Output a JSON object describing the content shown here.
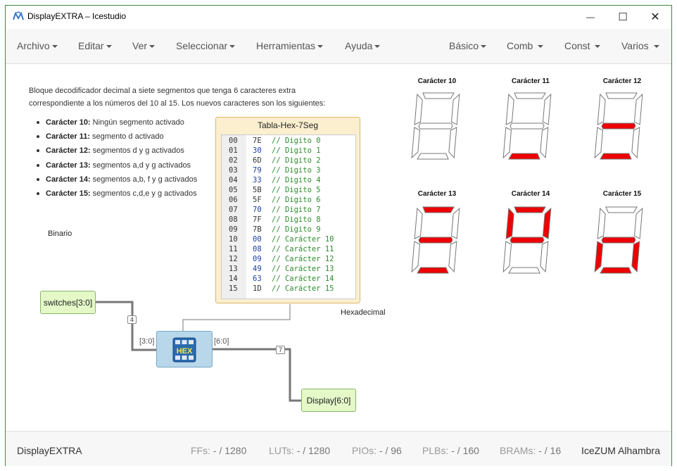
{
  "window": {
    "title": "DisplayEXTRA – Icestudio",
    "controls": {
      "minimize": "—",
      "maximize": "☐",
      "close": "✕"
    }
  },
  "menubar": {
    "left": [
      "Archivo",
      "Editar",
      "Ver",
      "Seleccionar",
      "Herramientas",
      "Ayuda"
    ],
    "right": [
      "Básico",
      "Comb",
      "Const",
      "Varios"
    ]
  },
  "canvas": {
    "description_line1": "Bloque decodificador decimal a siete segmentos que tenga 6 caracteres extra",
    "description_line2": "correspondiente a los números del 10 al 15. Los nuevos caracteres son los siguientes:",
    "bullets": [
      {
        "bold": "Carácter 10:",
        "text": " Ningún segmento activado"
      },
      {
        "bold": "Carácter 11:",
        "text": " segmento d activado"
      },
      {
        "bold": "Carácter 12:",
        "text": " segmentos d y g activados"
      },
      {
        "bold": "Carácter 13:",
        "text": " segmentos a,d y g activados"
      },
      {
        "bold": "Carácter 14:",
        "text": " segmentos a,b, f y g activados"
      },
      {
        "bold": "Carácter 15:",
        "text": " segmentos c,d,e y g activados"
      }
    ],
    "label_binario": "Binario",
    "label_hexadecimal": "Hexadecimal",
    "memory": {
      "title": "Tabla-Hex-7Seg",
      "rows": [
        {
          "addr": "00",
          "val": "7E",
          "comment": "// Digito 0",
          "blue": false
        },
        {
          "addr": "01",
          "val": "30",
          "comment": "// Digito 1",
          "blue": true
        },
        {
          "addr": "02",
          "val": "6D",
          "comment": "// Digito 2",
          "blue": false
        },
        {
          "addr": "03",
          "val": "79",
          "comment": "// Digito 3",
          "blue": true
        },
        {
          "addr": "04",
          "val": "33",
          "comment": "// Digito 4",
          "blue": true
        },
        {
          "addr": "05",
          "val": "5B",
          "comment": "// Digito 5",
          "blue": false
        },
        {
          "addr": "06",
          "val": "5F",
          "comment": "// Digito 6",
          "blue": false
        },
        {
          "addr": "07",
          "val": "70",
          "comment": "// Digito 7",
          "blue": true
        },
        {
          "addr": "08",
          "val": "7F",
          "comment": "// Digito 8",
          "blue": false
        },
        {
          "addr": "09",
          "val": "7B",
          "comment": "// Digito 9",
          "blue": false
        },
        {
          "addr": "10",
          "val": "00",
          "comment": "// Carácter 10",
          "blue": true
        },
        {
          "addr": "11",
          "val": "08",
          "comment": "// Carácter 11",
          "blue": true
        },
        {
          "addr": "12",
          "val": "09",
          "comment": "// Carácter 12",
          "blue": true
        },
        {
          "addr": "13",
          "val": "49",
          "comment": "// Carácter 13",
          "blue": true
        },
        {
          "addr": "14",
          "val": "63",
          "comment": "// Carácter 14",
          "blue": true
        },
        {
          "addr": "15",
          "val": "1D",
          "comment": "// Carácter 15",
          "blue": false
        }
      ]
    },
    "input_port": "switches[3:0]",
    "output_port": "Display[6:0]",
    "hex_block": {
      "label": "HEX",
      "input_pin": "[3:0]",
      "output_pin": "[6:0]"
    },
    "bus_in_width": "4",
    "bus_out_width": "7",
    "segment_on_color": "#ee0000",
    "characters": [
      {
        "title": "Carácter 10",
        "on": []
      },
      {
        "title": "Carácter 11",
        "on": [
          "d"
        ]
      },
      {
        "title": "Carácter 12",
        "on": [
          "d",
          "g"
        ]
      },
      {
        "title": "Carácter 13",
        "on": [
          "a",
          "d",
          "g"
        ]
      },
      {
        "title": "Carácter 14",
        "on": [
          "a",
          "b",
          "f",
          "g"
        ]
      },
      {
        "title": "Carácter 15",
        "on": [
          "c",
          "d",
          "e",
          "g"
        ]
      }
    ]
  },
  "statusbar": {
    "project": "DisplayEXTRA",
    "ffs_label": "FFs:",
    "ffs_value": "- / 1280",
    "luts_label": "LUTs:",
    "luts_value": "- / 1280",
    "pios_label": "PIOs:",
    "pios_value": "- / 96",
    "plbs_label": "PLBs:",
    "plbs_value": "- / 160",
    "brams_label": "BRAMs:",
    "brams_value": "- / 16",
    "board": "IceZUM Alhambra"
  }
}
